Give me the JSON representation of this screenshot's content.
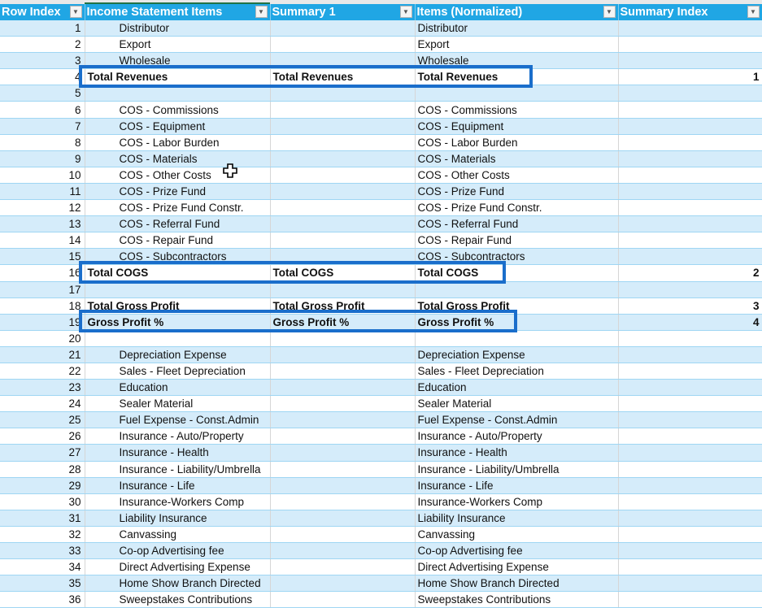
{
  "columns": [
    {
      "label": "Row Index"
    },
    {
      "label": "Income Statement Items"
    },
    {
      "label": "Summary 1"
    },
    {
      "label": "Items (Normalized)"
    },
    {
      "label": "Summary Index"
    }
  ],
  "rows": [
    {
      "index": "1",
      "item": "Distributor",
      "summary1": "",
      "normalized": "Distributor",
      "summary_index": "",
      "bold": false
    },
    {
      "index": "2",
      "item": "Export",
      "summary1": "",
      "normalized": "Export",
      "summary_index": "",
      "bold": false
    },
    {
      "index": "3",
      "item": "Wholesale",
      "summary1": "",
      "normalized": "Wholesale",
      "summary_index": "",
      "bold": false
    },
    {
      "index": "4",
      "item": "Total Revenues",
      "summary1": "Total Revenues",
      "normalized": "Total Revenues",
      "summary_index": "1",
      "bold": true
    },
    {
      "index": "5",
      "item": "",
      "summary1": "",
      "normalized": "",
      "summary_index": "",
      "bold": false
    },
    {
      "index": "6",
      "item": "COS - Commissions",
      "summary1": "",
      "normalized": "COS - Commissions",
      "summary_index": "",
      "bold": false
    },
    {
      "index": "7",
      "item": "COS - Equipment",
      "summary1": "",
      "normalized": "COS - Equipment",
      "summary_index": "",
      "bold": false
    },
    {
      "index": "8",
      "item": "COS - Labor Burden",
      "summary1": "",
      "normalized": "COS - Labor Burden",
      "summary_index": "",
      "bold": false
    },
    {
      "index": "9",
      "item": "COS - Materials",
      "summary1": "",
      "normalized": "COS - Materials",
      "summary_index": "",
      "bold": false
    },
    {
      "index": "10",
      "item": "COS - Other Costs",
      "summary1": "",
      "normalized": "COS - Other Costs",
      "summary_index": "",
      "bold": false
    },
    {
      "index": "11",
      "item": "COS - Prize Fund",
      "summary1": "",
      "normalized": "COS - Prize Fund",
      "summary_index": "",
      "bold": false
    },
    {
      "index": "12",
      "item": "COS - Prize Fund Constr.",
      "summary1": "",
      "normalized": "COS - Prize Fund Constr.",
      "summary_index": "",
      "bold": false
    },
    {
      "index": "13",
      "item": "COS - Referral Fund",
      "summary1": "",
      "normalized": "COS - Referral Fund",
      "summary_index": "",
      "bold": false
    },
    {
      "index": "14",
      "item": "COS - Repair Fund",
      "summary1": "",
      "normalized": "COS - Repair Fund",
      "summary_index": "",
      "bold": false
    },
    {
      "index": "15",
      "item": "COS - Subcontractors",
      "summary1": "",
      "normalized": "COS - Subcontractors",
      "summary_index": "",
      "bold": false
    },
    {
      "index": "16",
      "item": "Total COGS",
      "summary1": "Total COGS",
      "normalized": "Total COGS",
      "summary_index": "2",
      "bold": true
    },
    {
      "index": "17",
      "item": "",
      "summary1": "",
      "normalized": "",
      "summary_index": "",
      "bold": false
    },
    {
      "index": "18",
      "item": "Total Gross Profit",
      "summary1": "Total Gross Profit",
      "normalized": "Total Gross Profit",
      "summary_index": "3",
      "bold": true
    },
    {
      "index": "19",
      "item": "Gross Profit %",
      "summary1": "Gross Profit %",
      "normalized": "Gross Profit %",
      "summary_index": "4",
      "bold": true
    },
    {
      "index": "20",
      "item": "",
      "summary1": "",
      "normalized": "",
      "summary_index": "",
      "bold": false
    },
    {
      "index": "21",
      "item": "Depreciation Expense",
      "summary1": "",
      "normalized": "Depreciation Expense",
      "summary_index": "",
      "bold": false
    },
    {
      "index": "22",
      "item": "Sales - Fleet Depreciation",
      "summary1": "",
      "normalized": "Sales - Fleet Depreciation",
      "summary_index": "",
      "bold": false
    },
    {
      "index": "23",
      "item": "Education",
      "summary1": "",
      "normalized": "Education",
      "summary_index": "",
      "bold": false
    },
    {
      "index": "24",
      "item": "Sealer Material",
      "summary1": "",
      "normalized": "Sealer Material",
      "summary_index": "",
      "bold": false
    },
    {
      "index": "25",
      "item": "Fuel Expense - Const.Admin",
      "summary1": "",
      "normalized": "Fuel Expense - Const.Admin",
      "summary_index": "",
      "bold": false
    },
    {
      "index": "26",
      "item": "Insurance - Auto/Property",
      "summary1": "",
      "normalized": "Insurance - Auto/Property",
      "summary_index": "",
      "bold": false
    },
    {
      "index": "27",
      "item": "Insurance - Health",
      "summary1": "",
      "normalized": "Insurance - Health",
      "summary_index": "",
      "bold": false
    },
    {
      "index": "28",
      "item": "Insurance - Liability/Umbrella",
      "summary1": "",
      "normalized": "Insurance - Liability/Umbrella",
      "summary_index": "",
      "bold": false
    },
    {
      "index": "29",
      "item": "Insurance - Life",
      "summary1": "",
      "normalized": "Insurance - Life",
      "summary_index": "",
      "bold": false
    },
    {
      "index": "30",
      "item": "Insurance-Workers Comp",
      "summary1": "",
      "normalized": "Insurance-Workers Comp",
      "summary_index": "",
      "bold": false
    },
    {
      "index": "31",
      "item": "Liability Insurance",
      "summary1": "",
      "normalized": "Liability Insurance",
      "summary_index": "",
      "bold": false
    },
    {
      "index": "32",
      "item": "Canvassing",
      "summary1": "",
      "normalized": "Canvassing",
      "summary_index": "",
      "bold": false
    },
    {
      "index": "33",
      "item": "Co-op Advertising fee",
      "summary1": "",
      "normalized": "Co-op Advertising fee",
      "summary_index": "",
      "bold": false
    },
    {
      "index": "34",
      "item": "Direct Advertising Expense",
      "summary1": "",
      "normalized": "Direct Advertising Expense",
      "summary_index": "",
      "bold": false
    },
    {
      "index": "35",
      "item": "Home Show Branch Directed",
      "summary1": "",
      "normalized": "Home Show Branch Directed",
      "summary_index": "",
      "bold": false
    },
    {
      "index": "36",
      "item": "Sweepstakes Contributions",
      "summary1": "",
      "normalized": "Sweepstakes Contributions",
      "summary_index": "",
      "bold": false
    }
  ],
  "highlights": [
    {
      "label": "Total Revenues",
      "row": "4"
    },
    {
      "label": "Total COGS",
      "row": "16"
    },
    {
      "label": "Gross Profit %",
      "row": "19"
    }
  ],
  "colors": {
    "header_bg": "#20a6e4",
    "band_bg": "#d5ecfa",
    "highlight_border": "#1a6ecb"
  }
}
